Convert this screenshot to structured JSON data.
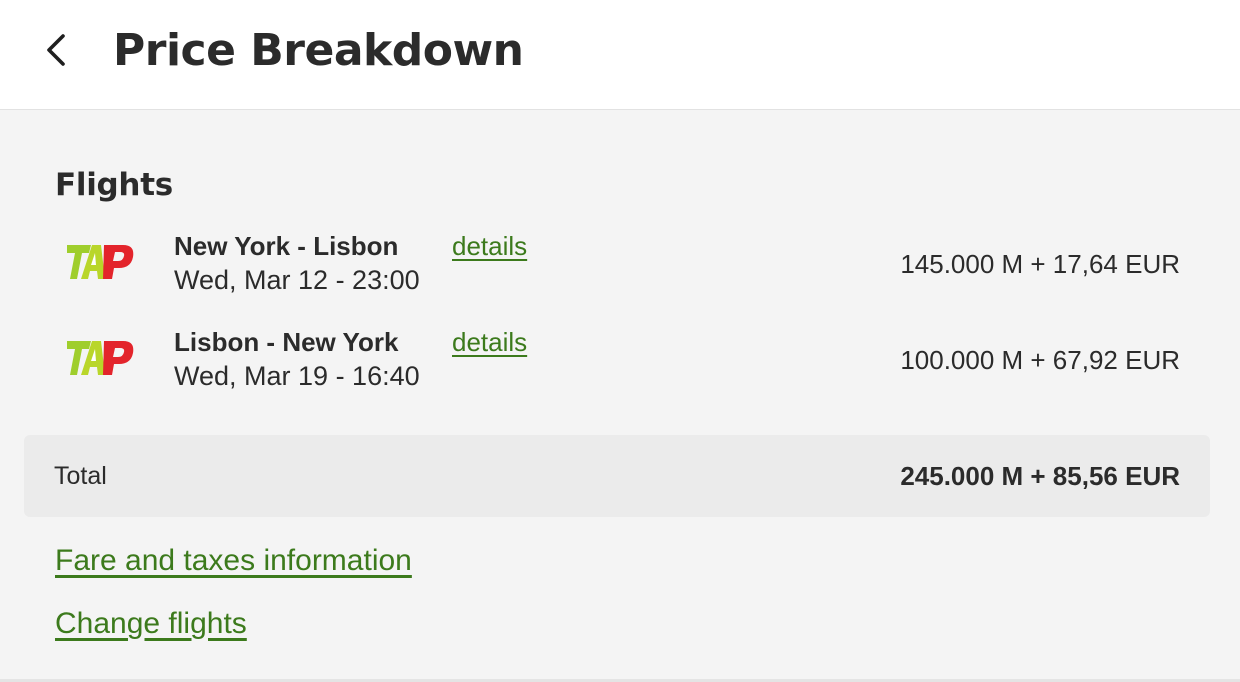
{
  "header": {
    "title": "Price Breakdown",
    "back_icon": "chevron-left-icon"
  },
  "flights": {
    "section_title": "Flights",
    "items": [
      {
        "airline_logo": "TAP",
        "route": "New York - Lisbon",
        "details_label": "details",
        "datetime": "Wed, Mar 12 - 23:00",
        "price": "145.000 M + 17,64 EUR"
      },
      {
        "airline_logo": "TAP",
        "route": "Lisbon - New York",
        "details_label": "details",
        "datetime": "Wed, Mar 19 - 16:40",
        "price": "100.000 M + 67,92 EUR"
      }
    ]
  },
  "total": {
    "label": "Total",
    "value": "245.000 M + 85,56 EUR"
  },
  "links": {
    "fare_info": "Fare and taxes information",
    "change_flights": "Change flights"
  },
  "colors": {
    "link": "#3c7a1c",
    "tap_green": "#9fce2c",
    "tap_red": "#e3242b",
    "background": "#f4f4f4",
    "total_bar": "#ebebeb"
  }
}
